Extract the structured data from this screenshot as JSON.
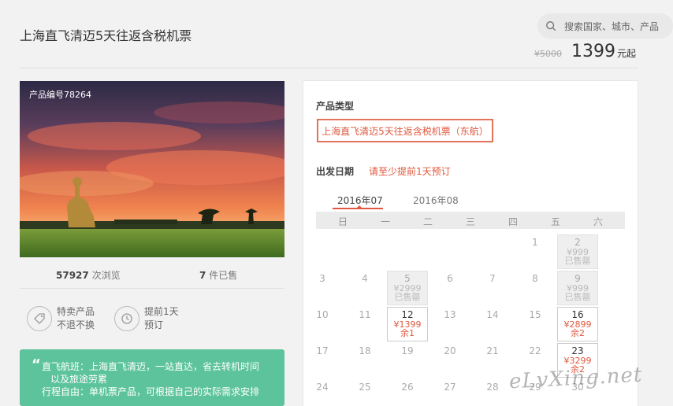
{
  "search": {
    "placeholder": "搜索国家、城市、产品"
  },
  "product": {
    "title": "上海直飞清迈5天往返含税机票",
    "old_price": "¥5000",
    "price": "1399",
    "price_unit": "元起",
    "code": "产品编号78264"
  },
  "stats": {
    "views_num": "57927",
    "views_label": "次浏览",
    "sold_num": "7",
    "sold_label": "件已售"
  },
  "features": [
    {
      "icon": "tag-icon",
      "line1": "特卖产品",
      "line2": "不退不换"
    },
    {
      "icon": "clock-icon",
      "line1": "提前1天",
      "line2": "预订"
    }
  ],
  "note": {
    "line1": "直飞航班：上海直飞清迈，一站直达，省去转机时间",
    "line2": "以及旅途劳累",
    "line3": "行程自由：单机票产品，可根据自己的实际需求安排"
  },
  "booking": {
    "type_label": "产品类型",
    "type_option": "上海直飞清迈5天往返含税机票（东航）",
    "date_label": "出发日期",
    "advance_note": "请至少提前1天预订",
    "months": [
      "2016年07",
      "2016年08"
    ],
    "weekdays": [
      "日",
      "一",
      "二",
      "三",
      "四",
      "五",
      "六"
    ]
  },
  "calendar": {
    "days": [
      {
        "d": "1"
      },
      {
        "d": "2",
        "price": "¥999",
        "status": "已售罄",
        "state": "soldout"
      },
      {
        "d": "3"
      },
      {
        "d": "4"
      },
      {
        "d": "5",
        "price": "¥2999",
        "status": "已售罄",
        "state": "soldout"
      },
      {
        "d": "6"
      },
      {
        "d": "7"
      },
      {
        "d": "8"
      },
      {
        "d": "9",
        "price": "¥999",
        "status": "已售罄",
        "state": "soldout"
      },
      {
        "d": "10"
      },
      {
        "d": "11"
      },
      {
        "d": "12",
        "price": "¥1399",
        "status": "余1",
        "state": "avail"
      },
      {
        "d": "13"
      },
      {
        "d": "14"
      },
      {
        "d": "15"
      },
      {
        "d": "16",
        "price": "¥2899",
        "status": "余2",
        "state": "avail"
      },
      {
        "d": "17"
      },
      {
        "d": "18"
      },
      {
        "d": "19"
      },
      {
        "d": "20"
      },
      {
        "d": "21"
      },
      {
        "d": "22"
      },
      {
        "d": "23",
        "price": "¥3299",
        "status": "余2",
        "state": "avail"
      },
      {
        "d": "24"
      },
      {
        "d": "25"
      },
      {
        "d": "26"
      },
      {
        "d": "27"
      },
      {
        "d": "28"
      },
      {
        "d": "29"
      },
      {
        "d": "30"
      }
    ]
  },
  "watermark": "eLvXing.net",
  "colors": {
    "accent": "#e0583f",
    "note_bg": "#5cc39d"
  }
}
